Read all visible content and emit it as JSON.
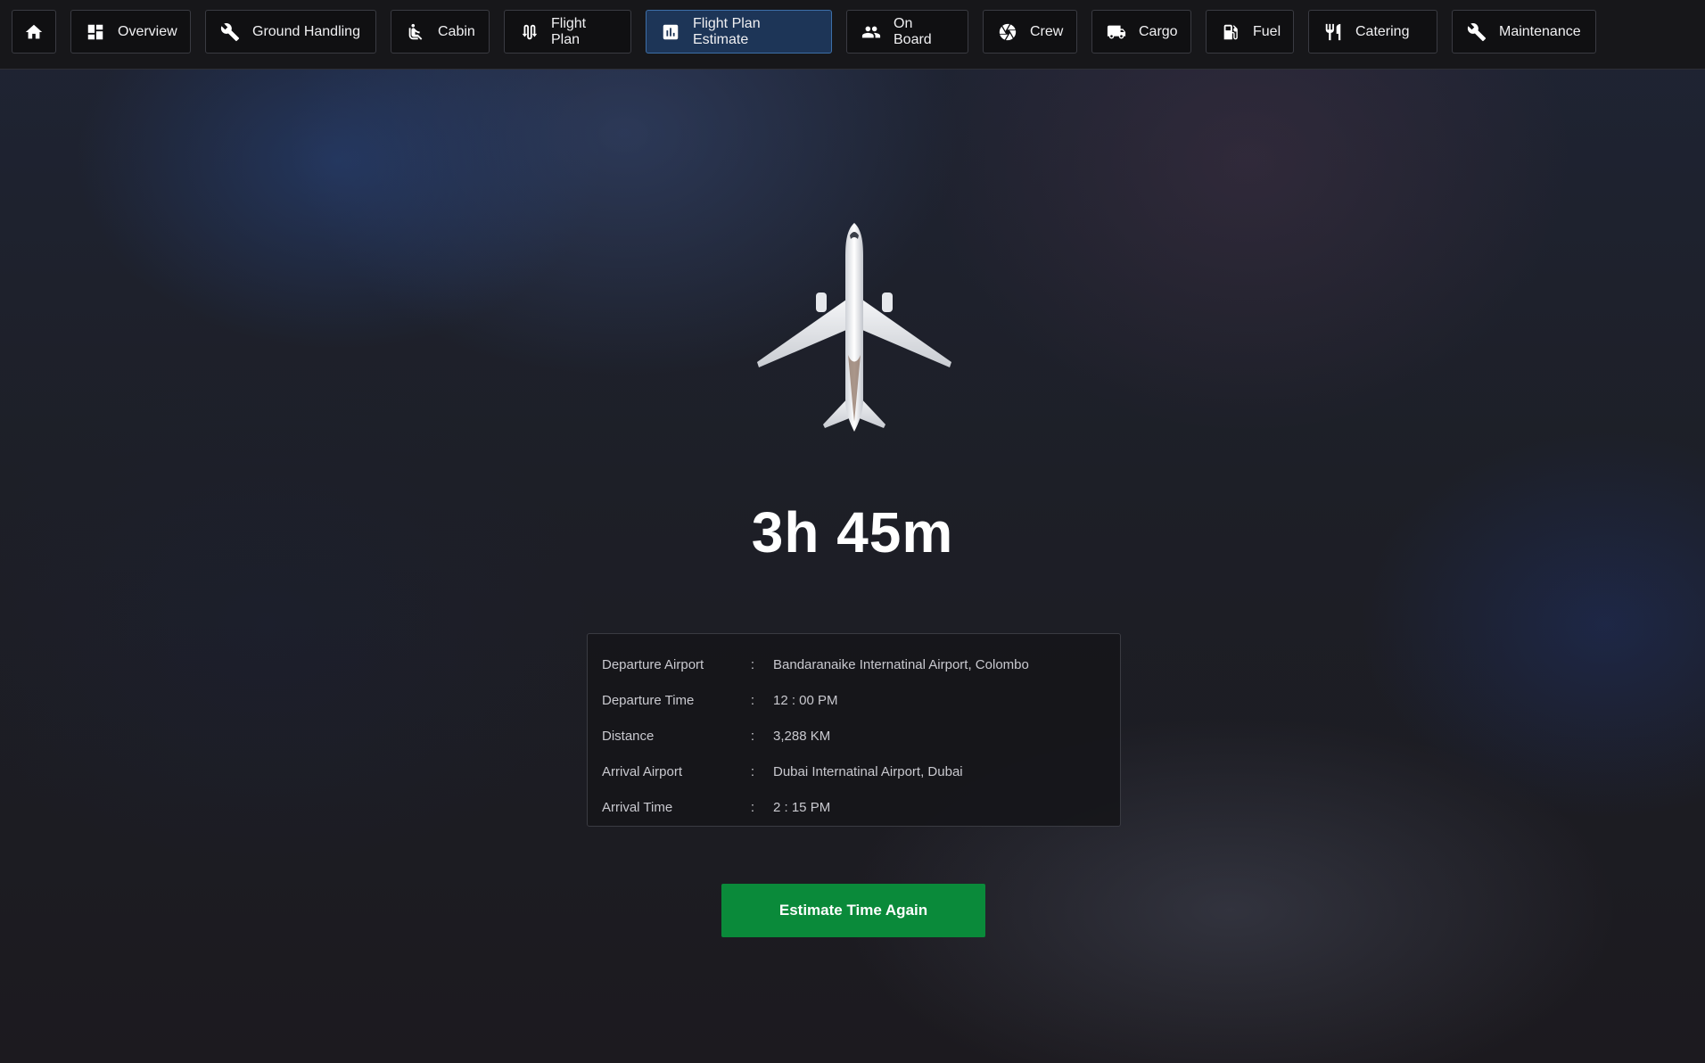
{
  "nav": {
    "home_icon": "home-icon",
    "items": [
      {
        "label": "Overview",
        "icon": "dashboard-icon"
      },
      {
        "label": "Ground Handling",
        "icon": "wrench-icon"
      },
      {
        "label": "Cabin",
        "icon": "seat-icon"
      },
      {
        "label": "Flight Plan",
        "icon": "route-icon"
      },
      {
        "label": "Flight Plan Estimate",
        "icon": "chart-icon",
        "active": true
      },
      {
        "label": "On Board",
        "icon": "people-icon"
      },
      {
        "label": "Crew",
        "icon": "aperture-icon"
      },
      {
        "label": "Cargo",
        "icon": "truck-icon"
      },
      {
        "label": "Fuel",
        "icon": "fuel-icon"
      },
      {
        "label": "Catering",
        "icon": "utensils-icon"
      },
      {
        "label": "Maintenance",
        "icon": "wrench-icon"
      }
    ]
  },
  "main": {
    "duration": "3h 45m",
    "details": [
      {
        "label": "Departure Airport",
        "sep": ":",
        "value": "Bandaranaike Internatinal Airport, Colombo"
      },
      {
        "label": "Departure Time",
        "sep": ":",
        "value": "12 : 00 PM"
      },
      {
        "label": "Distance",
        "sep": ":",
        "value": "3,288 KM"
      },
      {
        "label": "Arrival Airport",
        "sep": ":",
        "value": "Dubai Internatinal Airport, Dubai"
      },
      {
        "label": "Arrival Time",
        "sep": ":",
        "value": "2 : 15 PM"
      }
    ],
    "estimate_button": "Estimate Time Again"
  },
  "colors": {
    "active_tab": "#1d3557",
    "primary_button": "#0a8a3a"
  }
}
